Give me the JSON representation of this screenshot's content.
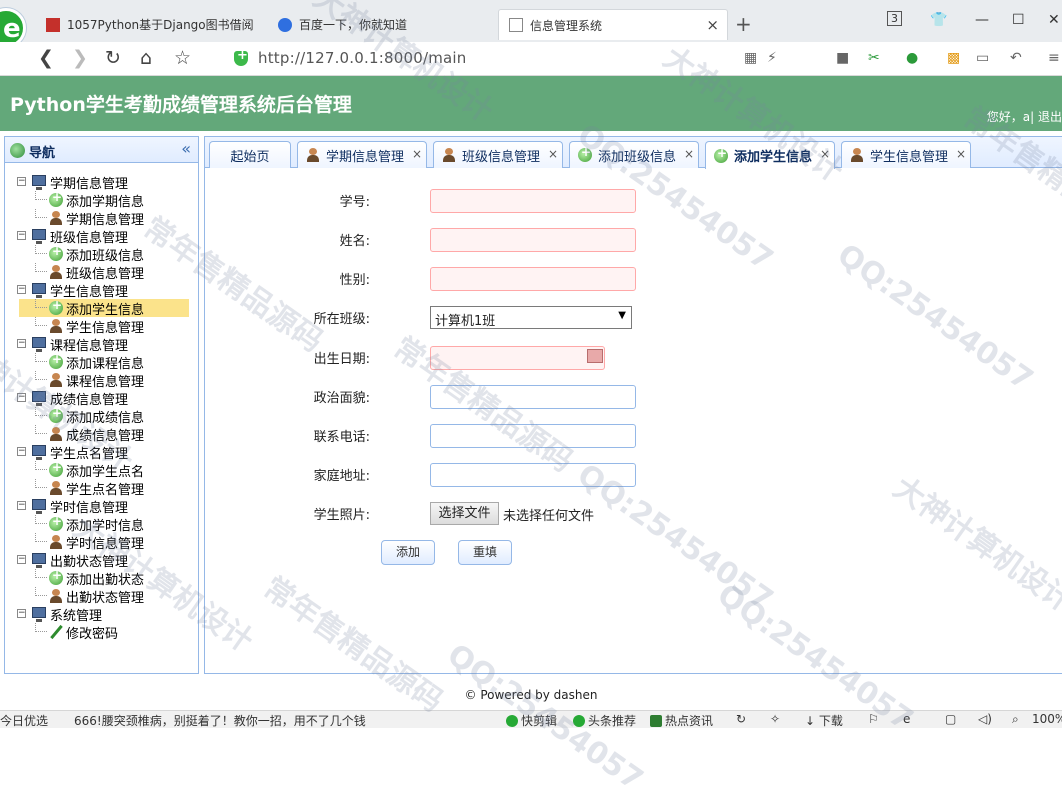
{
  "browser": {
    "tabs": [
      {
        "title": "1057Python基于Django图书借阅"
      },
      {
        "title": "百度一下，你就知道"
      },
      {
        "title": "信息管理系统"
      }
    ],
    "tab_counter": "3",
    "url": "http://127.0.0.1:8000/main"
  },
  "header": {
    "title": "Python学生考勤成绩管理系统后台管理",
    "user_text": "您好，a| 退出"
  },
  "nav": {
    "title": "导航",
    "groups": [
      {
        "label": "学期信息管理",
        "children": [
          {
            "label": "添加学期信息",
            "icon": "add-icon"
          },
          {
            "label": "学期信息管理",
            "icon": "user-icon"
          }
        ]
      },
      {
        "label": "班级信息管理",
        "children": [
          {
            "label": "添加班级信息",
            "icon": "add-icon"
          },
          {
            "label": "班级信息管理",
            "icon": "user-icon"
          }
        ]
      },
      {
        "label": "学生信息管理",
        "children": [
          {
            "label": "添加学生信息",
            "icon": "add-icon"
          },
          {
            "label": "学生信息管理",
            "icon": "user-icon"
          }
        ]
      },
      {
        "label": "课程信息管理",
        "children": [
          {
            "label": "添加课程信息",
            "icon": "add-icon"
          },
          {
            "label": "课程信息管理",
            "icon": "user-icon"
          }
        ]
      },
      {
        "label": "成绩信息管理",
        "children": [
          {
            "label": "添加成绩信息",
            "icon": "add-icon"
          },
          {
            "label": "成绩信息管理",
            "icon": "user-icon"
          }
        ]
      },
      {
        "label": "学生点名管理",
        "children": [
          {
            "label": "添加学生点名",
            "icon": "add-icon"
          },
          {
            "label": "学生点名管理",
            "icon": "user-icon"
          }
        ]
      },
      {
        "label": "学时信息管理",
        "children": [
          {
            "label": "添加学时信息",
            "icon": "add-icon"
          },
          {
            "label": "学时信息管理",
            "icon": "user-icon"
          }
        ]
      },
      {
        "label": "出勤状态管理",
        "children": [
          {
            "label": "添加出勤状态",
            "icon": "add-icon"
          },
          {
            "label": "出勤状态管理",
            "icon": "user-icon"
          }
        ]
      },
      {
        "label": "系统管理",
        "children": [
          {
            "label": "修改密码",
            "icon": "pen-icon"
          }
        ]
      }
    ],
    "selected": "添加学生信息"
  },
  "content_tabs": [
    {
      "label": "起始页",
      "icon": "",
      "closable": false
    },
    {
      "label": "学期信息管理",
      "icon": "user-icon",
      "closable": true
    },
    {
      "label": "班级信息管理",
      "icon": "user-icon",
      "closable": true
    },
    {
      "label": "添加班级信息",
      "icon": "add-icon",
      "closable": true
    },
    {
      "label": "添加学生信息",
      "icon": "add-icon",
      "closable": true,
      "active": true
    },
    {
      "label": "学生信息管理",
      "icon": "user-icon",
      "closable": true
    }
  ],
  "form": {
    "student_no_label": "学号:",
    "student_no_value": "",
    "name_label": "姓名:",
    "name_value": "",
    "gender_label": "性别:",
    "gender_value": "",
    "class_label": "所在班级:",
    "class_value": "计算机1班",
    "birthday_label": "出生日期:",
    "birthday_value": "",
    "politics_label": "政治面貌:",
    "politics_value": "",
    "phone_label": "联系电话:",
    "phone_value": "",
    "address_label": "家庭地址:",
    "address_value": "",
    "photo_label": "学生照片:",
    "file_button": "选择文件",
    "file_status": "未选择任何文件",
    "submit_label": "添加",
    "reset_label": "重填"
  },
  "footer": "© Powered by dashen",
  "statusbar": {
    "left": "今日优选",
    "news": "666!腰突颈椎病，别挺着了！教你一招，用不了几个钱",
    "quick_clip": "快剪辑",
    "headline": "头条推荐",
    "hot_news": "热点资讯",
    "download": "下载",
    "zoom": "100%"
  },
  "watermark": [
    "大神计算机设计",
    "QQ:25454057",
    "常年售精品源码"
  ]
}
